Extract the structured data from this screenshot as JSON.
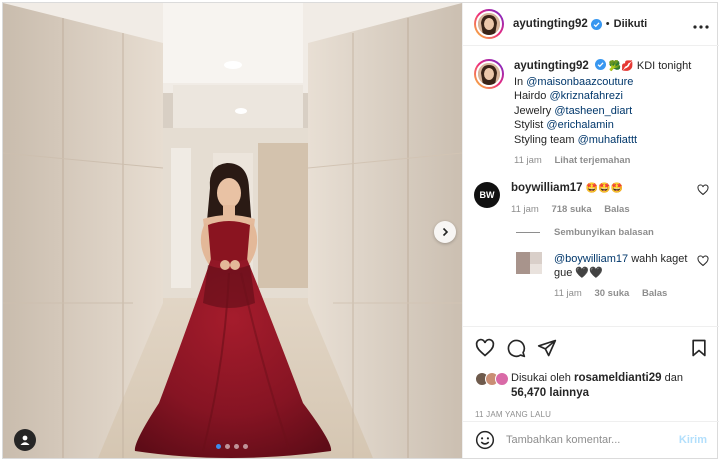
{
  "post": {
    "photo_alt": "",
    "carousel": {
      "count": 4,
      "active": 0
    },
    "icons": {
      "next": "chevron-right-icon",
      "tags": "user-tag-icon"
    }
  },
  "header": {
    "username": "ayutingting92",
    "separator": "•",
    "follow_status": "Diikuti",
    "more_icon": "more-horizontal-icon"
  },
  "caption": {
    "username": "ayutingting92",
    "emojis": "🥦💋",
    "line1_text": " KDI tonight",
    "line2_prefix": "In ",
    "line2_mention": "@maisonbaazcouture",
    "line3_prefix": "Hairdo ",
    "line3_mention": "@kriznafahrezi",
    "line4_prefix": "Jewelry ",
    "line4_mention": "@tasheen_diart",
    "line5_prefix": "Stylist ",
    "line5_mention": "@erichalamin",
    "line6_prefix": "Styling team ",
    "line6_mention": "@muhafiattt",
    "time": "11 jam",
    "translate": "Lihat terjemahan"
  },
  "comment1": {
    "avatar_text": "BW",
    "username": "boywilliam17",
    "text": "🤩🤩🤩",
    "time": "11 jam",
    "likes": "718 suka",
    "reply": "Balas"
  },
  "hide_replies": "Sembunyikan balasan",
  "reply1": {
    "mention": "@boywilliam17",
    "text": " wahh kaget gue 🖤🖤",
    "time": "11 jam",
    "likes": "30 suka",
    "reply": "Balas"
  },
  "likes": {
    "prefix": "Disukai oleh ",
    "user": "rosameldianti29",
    "mid": " dan ",
    "count": "56,470 lainnya"
  },
  "timestamp": "11 JAM YANG LALU",
  "add_comment": {
    "placeholder": "Tambahkan komentar...",
    "post_label": "Kirim"
  },
  "colors": {
    "verified": "#3897f0",
    "mention": "#00376b",
    "muted": "#8e8e8e",
    "post_button": "#b2dffc",
    "dress": "#8a1420"
  }
}
